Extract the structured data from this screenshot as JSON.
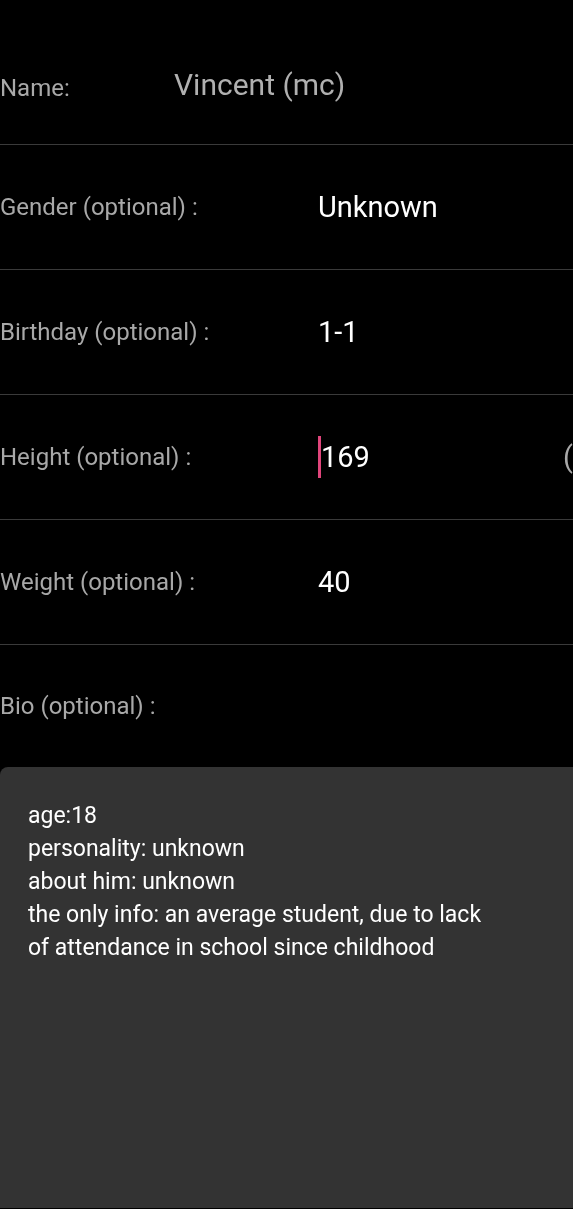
{
  "fields": [
    {
      "label": "Name:",
      "value": "Vincent (mc)",
      "disabled": true,
      "focused": false
    },
    {
      "label": "Gender (optional) :",
      "value": "Unknown",
      "disabled": false,
      "focused": false
    },
    {
      "label": "Birthday (optional) :",
      "value": "1-1",
      "disabled": false,
      "focused": false
    },
    {
      "label": "Height (optional) :",
      "value": "169",
      "disabled": false,
      "focused": true,
      "unit": "("
    },
    {
      "label": "Weight (optional) :",
      "value": "40",
      "disabled": false,
      "focused": false
    }
  ],
  "bio": {
    "label": "Bio (optional) :",
    "lines": [
      "age:18",
      "personality: unknown",
      "about him: unknown",
      "the only info: an average student, due to lack",
      "of attendance in school since childhood"
    ]
  }
}
